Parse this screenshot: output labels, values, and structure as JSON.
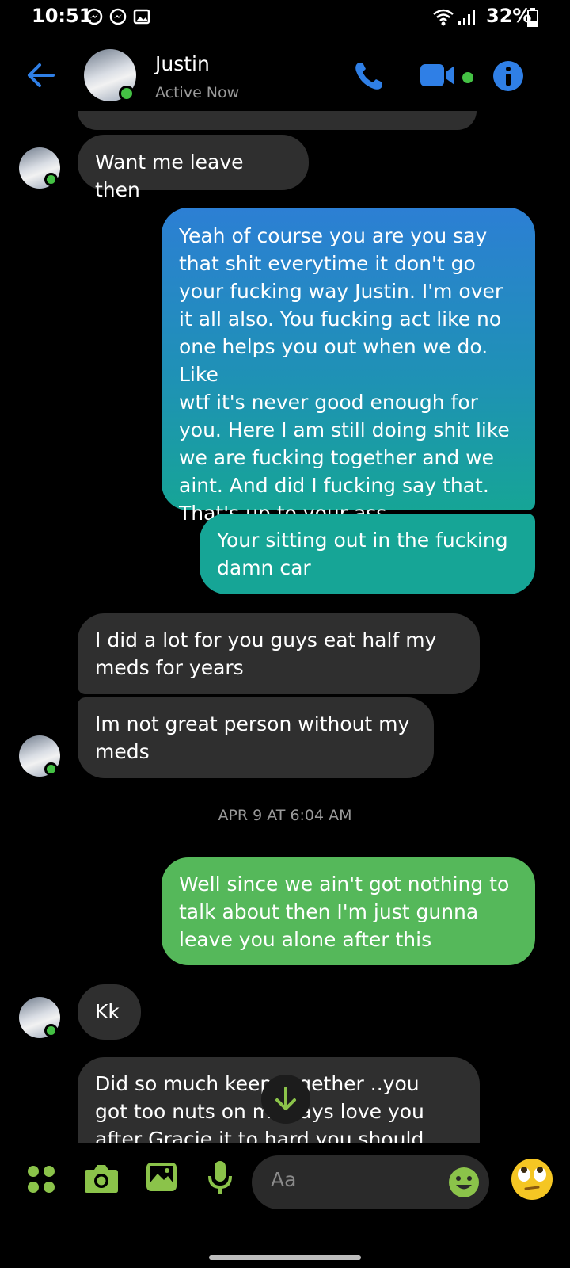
{
  "status_bar": {
    "time": "10:51",
    "battery_percent": "32%",
    "icons": [
      "messenger-icon",
      "messenger-icon",
      "gallery-icon",
      "wifi-icon",
      "signal-icon",
      "battery-icon"
    ]
  },
  "header": {
    "contact_name": "Justin",
    "status": "Active Now",
    "icons": [
      "back-arrow-icon",
      "phone-icon",
      "video-icon",
      "info-icon"
    ]
  },
  "messages": [
    {
      "from": "contact",
      "lines": [
        "Want me leave then"
      ]
    },
    {
      "from": "me",
      "lines": [
        "Yeah of course you are you say",
        "that shit everytime it don't go",
        "your fucking way Justin. I'm over",
        "it all also. You fucking act like no",
        "one helps you out when we do. Like",
        "wtf it's never good enough for",
        "you. Here I am still doing shit like",
        "we are fucking together and we",
        "aint. And did I fucking say that.",
        "That's up to your ass"
      ]
    },
    {
      "from": "me",
      "lines": [
        "Your sitting out in the fucking",
        "damn car"
      ]
    },
    {
      "from": "contact",
      "lines": [
        "I did a lot for you guys eat half my",
        "meds for years"
      ]
    },
    {
      "from": "contact",
      "lines": [
        "Im not great person without  my",
        "meds"
      ]
    },
    {
      "from": "me",
      "lines": [
        "Well since we ain't got nothing to",
        "talk about then I'm just gunna",
        "leave you alone after this"
      ]
    },
    {
      "from": "contact",
      "lines": [
        "Kk"
      ]
    },
    {
      "from": "contact",
      "lines": [
        "Did so much keep    together  ..you",
        "got too nuts on m    lways love you",
        "after Gracie it to hard    you should"
      ]
    }
  ],
  "timestamp": "APR 9 AT 6:04 AM",
  "composer": {
    "placeholder": "Aa",
    "icons": [
      "menu-dots-icon",
      "camera-icon",
      "image-icon",
      "microphone-icon",
      "emoji-icon",
      "eye-roll-emoji-icon"
    ]
  },
  "colors": {
    "accent_blue": "#2f7fe6",
    "green": "#55b85a",
    "teal": "#16a596",
    "bubble_in": "#2f2f2f",
    "composer_green": "#8bc34a"
  }
}
